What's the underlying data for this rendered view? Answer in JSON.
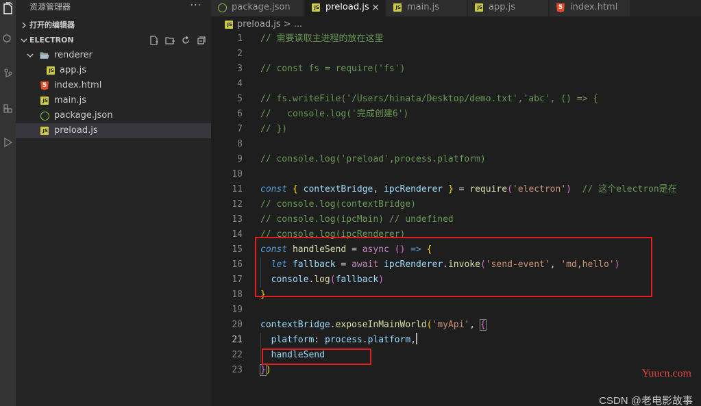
{
  "sidebar": {
    "title": "资源管理器",
    "more": "···",
    "open_editors": "打开的编辑器",
    "folder": "ELECTRON",
    "tree": [
      {
        "label": "renderer"
      },
      {
        "label": "app.js"
      },
      {
        "label": "index.html"
      },
      {
        "label": "main.js"
      },
      {
        "label": "package.json"
      },
      {
        "label": "preload.js"
      }
    ]
  },
  "tabs": [
    {
      "label": "package.json",
      "icon": "json-file-icon"
    },
    {
      "label": "preload.js",
      "icon": "js-file-icon",
      "close": "×"
    },
    {
      "label": "main.js",
      "icon": "js-file-icon"
    },
    {
      "label": "app.js",
      "icon": "js-file-icon"
    },
    {
      "label": "index.html",
      "icon": "html-file-icon"
    }
  ],
  "breadcrumb": {
    "text": "preload.js > ..."
  },
  "editor": {
    "line_numbers": [
      "1",
      "2",
      "3",
      "4",
      "5",
      "6",
      "7",
      "8",
      "9",
      "10",
      "11",
      "12",
      "13",
      "14",
      "15",
      "16",
      "17",
      "18",
      "19",
      "20",
      "21",
      "22",
      "23"
    ],
    "current_line": 21
  },
  "watermarks": {
    "yuucn": "Yuucn.com",
    "csdn": "CSDN @老电影故事"
  },
  "colors": {
    "accent_red": "#e02020",
    "background": "#1e1e1e",
    "sidebar": "#252526"
  }
}
